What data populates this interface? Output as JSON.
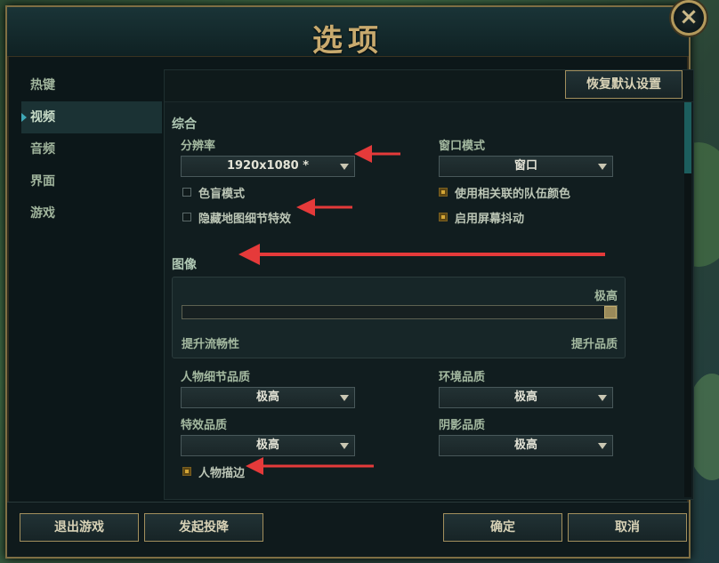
{
  "window": {
    "title": "选项",
    "close_icon": "×"
  },
  "sidebar": {
    "items": [
      {
        "label": "热键",
        "active": false
      },
      {
        "label": "视频",
        "active": true
      },
      {
        "label": "音频",
        "active": false
      },
      {
        "label": "界面",
        "active": false
      },
      {
        "label": "游戏",
        "active": false
      }
    ]
  },
  "toolbar": {
    "restore_defaults_label": "恢复默认设置"
  },
  "general": {
    "section_title": "综合",
    "resolution": {
      "label": "分辨率",
      "value": "1920x1080 *"
    },
    "window_mode": {
      "label": "窗口模式",
      "value": "窗口"
    },
    "colorblind": {
      "label": "色盲模式",
      "checked": false
    },
    "hide_map_effects": {
      "label": "隐藏地图细节特效",
      "checked": false
    },
    "team_colors": {
      "label": "使用相关联的队伍颜色",
      "checked": true
    },
    "screen_shake": {
      "label": "启用屏幕抖动",
      "checked": true
    }
  },
  "graphics": {
    "section_title": "图像",
    "level_label": "极高",
    "slider_min_label": "提升流畅性",
    "slider_max_label": "提升品质",
    "slider_value": 1.0,
    "character_quality": {
      "label": "人物细节品质",
      "value": "极高"
    },
    "environment_quality": {
      "label": "环境品质",
      "value": "极高"
    },
    "effects_quality": {
      "label": "特效品质",
      "value": "极高"
    },
    "shadow_quality": {
      "label": "阴影品质",
      "value": "极高"
    },
    "character_outline": {
      "label": "人物描边",
      "checked": true
    }
  },
  "footer": {
    "exit_label": "退出游戏",
    "surrender_label": "发起投降",
    "ok_label": "确定",
    "cancel_label": "取消"
  },
  "colors": {
    "accent_gold": "#c8aa6e",
    "annotation_red": "#e53a3a"
  }
}
